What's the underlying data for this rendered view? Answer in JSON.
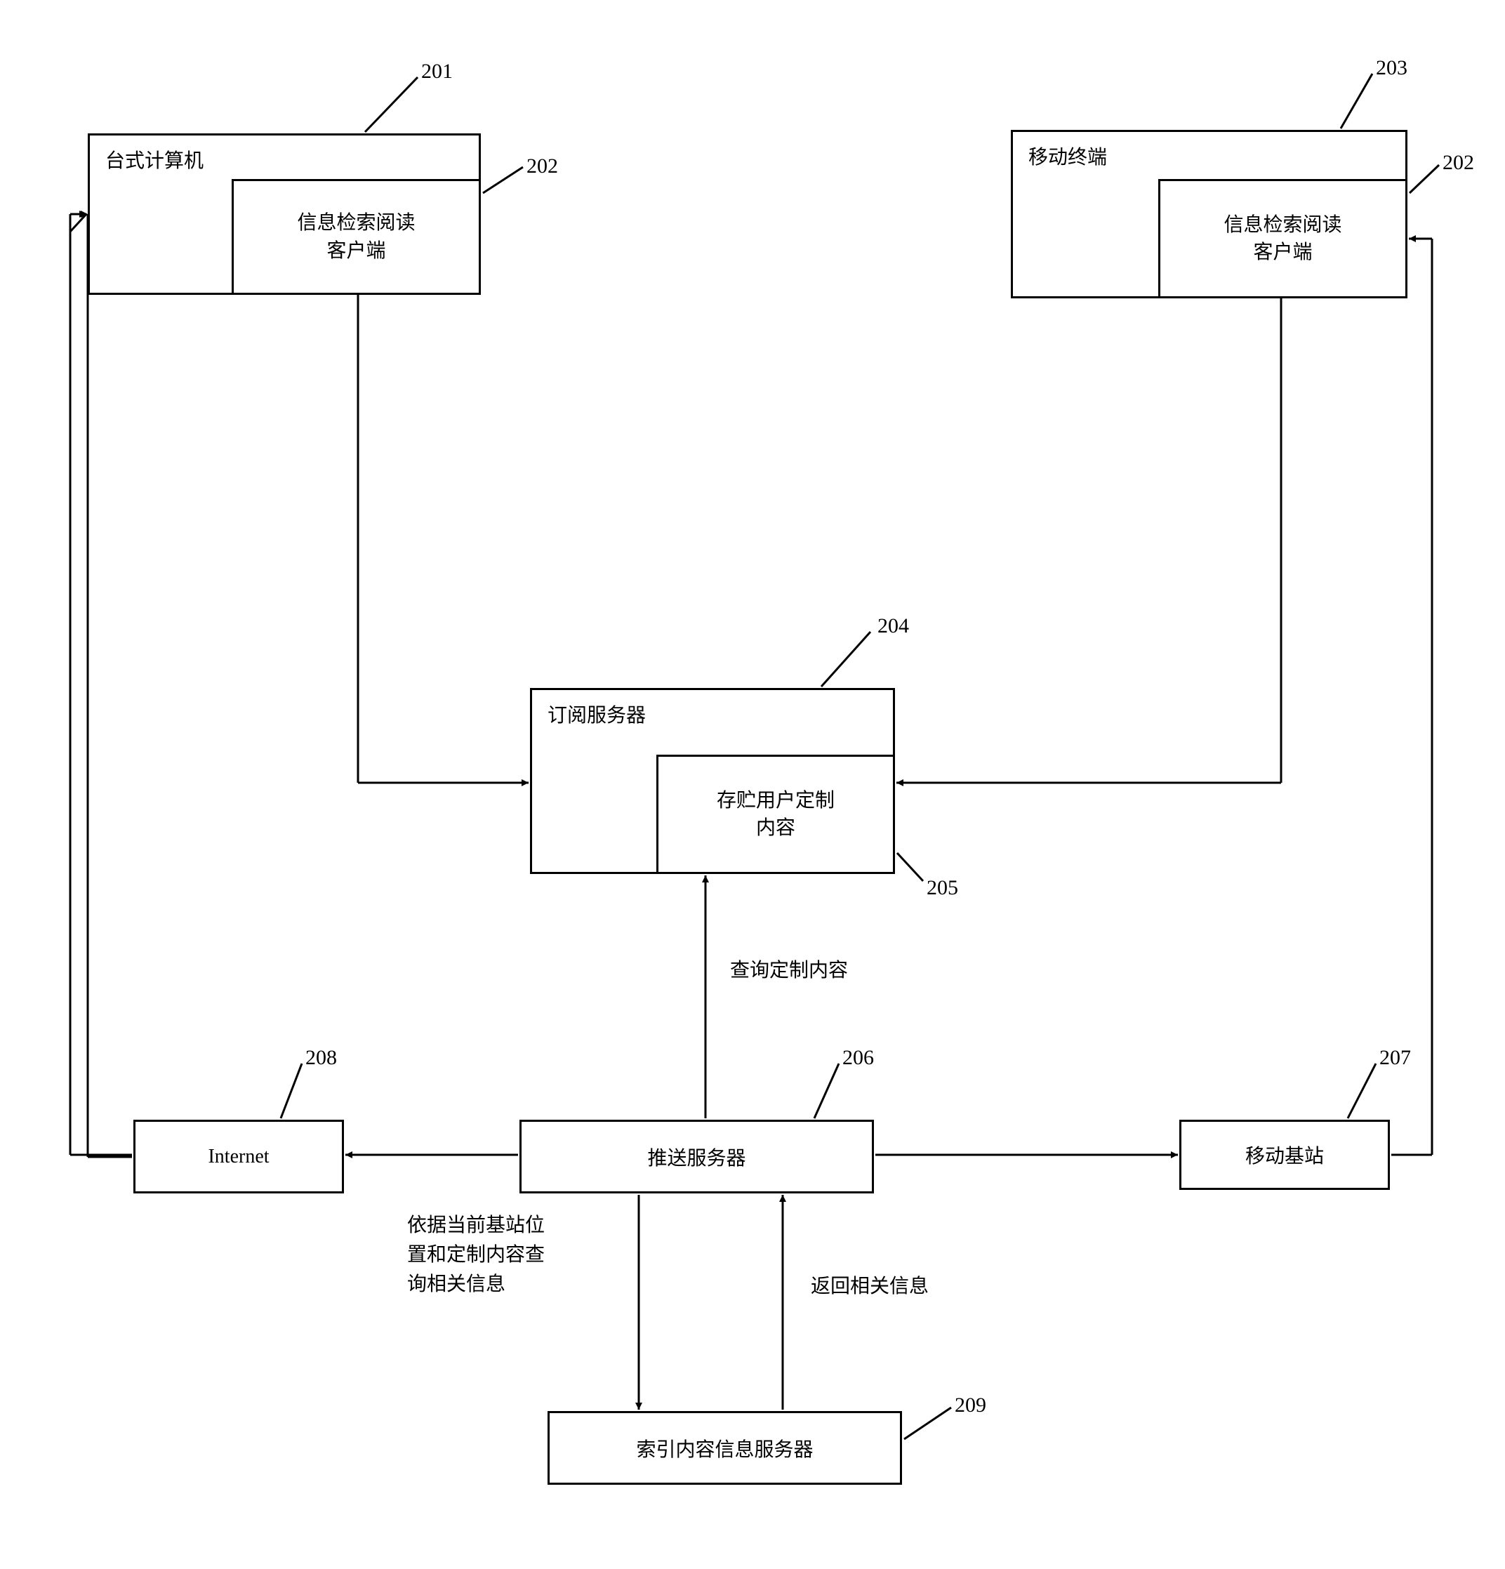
{
  "nodes": {
    "desktop": {
      "label": "台式计算机",
      "ref": "201"
    },
    "desktop_client": {
      "label": "信息检索阅读\n客户端",
      "ref": "202"
    },
    "mobile_terminal": {
      "label": "移动终端",
      "ref": "203"
    },
    "mobile_client": {
      "label": "信息检索阅读\n客户端",
      "ref": "202"
    },
    "sub_server": {
      "label": "订阅服务器",
      "ref": "204"
    },
    "sub_store": {
      "label": "存贮用户定制\n内容",
      "ref": "205"
    },
    "push_server": {
      "label": "推送服务器",
      "ref": "206"
    },
    "internet": {
      "label": "Internet",
      "ref": "208"
    },
    "base_station": {
      "label": "移动基站",
      "ref": "207"
    },
    "index_server": {
      "label": "索引内容信息服务器",
      "ref": "209"
    }
  },
  "edge_labels": {
    "query_custom": "查询定制内容",
    "query_by_base": "依据当前基站位\n置和定制内容查\n询相关信息",
    "return_info": "返回相关信息"
  },
  "chart_data": {
    "type": "diagram",
    "title": "",
    "nodes": [
      {
        "id": "201",
        "label": "台式计算机"
      },
      {
        "id": "202a",
        "label": "信息检索阅读客户端",
        "parent": "201"
      },
      {
        "id": "203",
        "label": "移动终端"
      },
      {
        "id": "202b",
        "label": "信息检索阅读客户端",
        "parent": "203"
      },
      {
        "id": "204",
        "label": "订阅服务器"
      },
      {
        "id": "205",
        "label": "存贮用户定制内容",
        "parent": "204"
      },
      {
        "id": "206",
        "label": "推送服务器"
      },
      {
        "id": "207",
        "label": "移动基站"
      },
      {
        "id": "208",
        "label": "Internet"
      },
      {
        "id": "209",
        "label": "索引内容信息服务器"
      }
    ],
    "edges": [
      {
        "from": "202a",
        "to": "204"
      },
      {
        "from": "202b",
        "to": "204"
      },
      {
        "from": "206",
        "to": "205",
        "label": "查询定制内容"
      },
      {
        "from": "206",
        "to": "208"
      },
      {
        "from": "206",
        "to": "207"
      },
      {
        "from": "208",
        "to": "201"
      },
      {
        "from": "207",
        "to": "203"
      },
      {
        "from": "206",
        "to": "209",
        "label": "依据当前基站位置和定制内容查询相关信息"
      },
      {
        "from": "209",
        "to": "206",
        "label": "返回相关信息"
      }
    ]
  }
}
